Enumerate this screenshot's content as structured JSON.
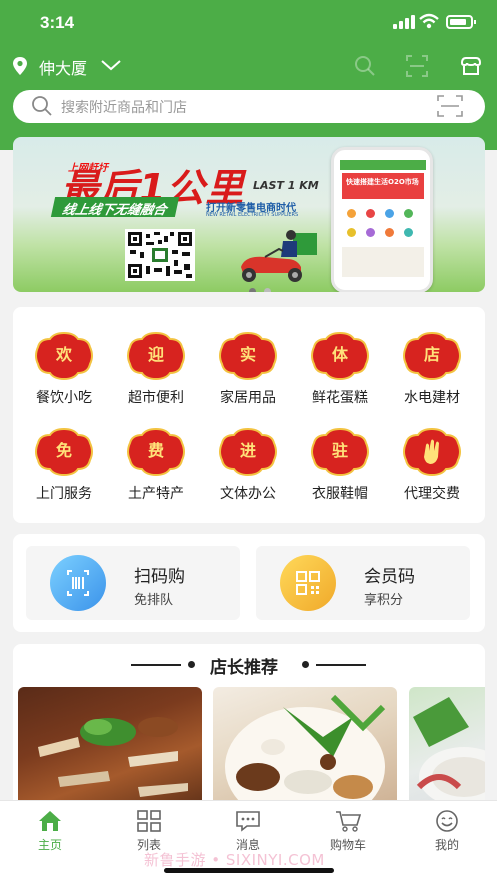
{
  "status_bar": {
    "time": "3:14"
  },
  "header": {
    "location": "伸大厦"
  },
  "search": {
    "placeholder": "搜索附近商品和门店"
  },
  "banner": {
    "tag": "上网赶圩",
    "headline": "最后1公里",
    "headline_en": "LAST 1 KM",
    "slogan": "线上线下无缝融合",
    "slogan2": "打开新零售电商时代",
    "slogan2_en": "NEW RETAIL ELECTRICITY SUPPLIERS",
    "phone_banner": "快速搭建生活O2O市场",
    "pager": {
      "count": 2,
      "active": 1
    }
  },
  "categories": [
    {
      "badge": "欢",
      "label": "餐饮小吃"
    },
    {
      "badge": "迎",
      "label": "超市便利"
    },
    {
      "badge": "实",
      "label": "家居用品"
    },
    {
      "badge": "体",
      "label": "鲜花蛋糕"
    },
    {
      "badge": "店",
      "label": "水电建材"
    },
    {
      "badge": "免",
      "label": "上门服务"
    },
    {
      "badge": "费",
      "label": "土产特产"
    },
    {
      "badge": "进",
      "label": "文体办公"
    },
    {
      "badge": "驻",
      "label": "衣服鞋帽"
    },
    {
      "badge": "",
      "label": "代理交费",
      "icon": "hand-icon"
    }
  ],
  "quick_actions": [
    {
      "title": "扫码购",
      "subtitle": "免排队",
      "icon": "barcode-scan-icon",
      "color": "#4aa8ef"
    },
    {
      "title": "会员码",
      "subtitle": "享积分",
      "icon": "qr-code-icon",
      "color": "#f2b730"
    }
  ],
  "recommend": {
    "title": "店长推荐"
  },
  "tabbar": [
    {
      "label": "主页",
      "icon": "home-icon",
      "active": true
    },
    {
      "label": "列表",
      "icon": "grid-icon"
    },
    {
      "label": "消息",
      "icon": "message-icon"
    },
    {
      "label": "购物车",
      "icon": "cart-icon"
    },
    {
      "label": "我的",
      "icon": "smile-icon"
    }
  ],
  "watermark": "新鲁手游 • SIXINYI.COM",
  "colors": {
    "brand": "#4cad47",
    "badge_red": "#d7231f",
    "badge_text": "#ffe27a"
  }
}
